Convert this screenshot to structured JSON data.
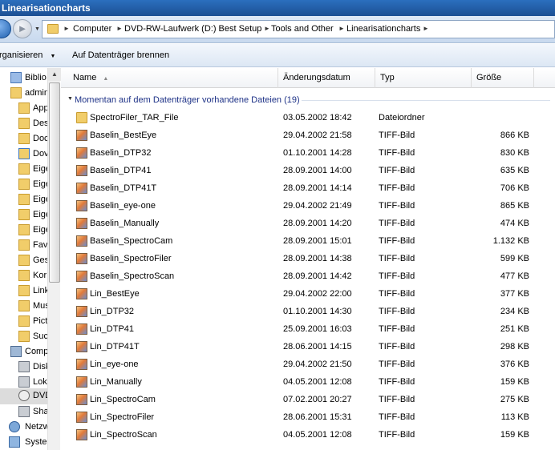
{
  "window": {
    "title": "Linearisationcharts"
  },
  "address": {
    "crumbs": [
      "Computer",
      "DVD-RW-Laufwerk (D:) Best Setup",
      "Tools and Other",
      "Linearisationcharts"
    ]
  },
  "toolbar": {
    "organize_label": "rganisieren",
    "burn_label": "Auf Datenträger brennen"
  },
  "navpane": {
    "items": [
      {
        "label": "Biblio",
        "icon": "library-icon"
      },
      {
        "label": "admin",
        "icon": "user-folder-icon"
      },
      {
        "label": "App",
        "icon": "folder-icon"
      },
      {
        "label": "Des",
        "icon": "folder-icon"
      },
      {
        "label": "Doc",
        "icon": "folder-icon"
      },
      {
        "label": "Dov",
        "icon": "download-folder-icon"
      },
      {
        "label": "Eige",
        "icon": "folder-icon"
      },
      {
        "label": "Eige",
        "icon": "folder-icon"
      },
      {
        "label": "Eige",
        "icon": "folder-icon"
      },
      {
        "label": "Eige",
        "icon": "folder-icon"
      },
      {
        "label": "Eige",
        "icon": "folder-icon"
      },
      {
        "label": "Fav",
        "icon": "folder-icon"
      },
      {
        "label": "Ges",
        "icon": "folder-icon"
      },
      {
        "label": "Kor",
        "icon": "folder-icon"
      },
      {
        "label": "Link",
        "icon": "folder-icon"
      },
      {
        "label": "Mus",
        "icon": "folder-icon"
      },
      {
        "label": "Pict",
        "icon": "folder-icon"
      },
      {
        "label": "Suc",
        "icon": "folder-icon"
      },
      {
        "label": "Comp",
        "icon": "computer-icon"
      },
      {
        "label": "Disk",
        "icon": "drive-icon"
      },
      {
        "label": "Lok",
        "icon": "drive-icon"
      },
      {
        "label": "DVD",
        "icon": "dvd-icon"
      },
      {
        "label": "Sha",
        "icon": "share-icon"
      },
      {
        "label": "Netzw",
        "icon": "network-icon"
      },
      {
        "label": "Syste",
        "icon": "control-panel-icon"
      }
    ]
  },
  "columns": {
    "name": "Name",
    "date": "Änderungsdatum",
    "type": "Typ",
    "size": "Größe"
  },
  "group_label": "Momentan auf dem Datenträger vorhandene Dateien (19)",
  "files": [
    {
      "name": "SpectroFiler_TAR_File",
      "date": "03.05.2002 18:42",
      "type": "Dateiordner",
      "size": "",
      "icon": "folder-icon"
    },
    {
      "name": "Baselin_BestEye",
      "date": "29.04.2002 21:58",
      "type": "TIFF-Bild",
      "size": "866 KB",
      "icon": "tiff-image-icon"
    },
    {
      "name": "Baselin_DTP32",
      "date": "01.10.2001 14:28",
      "type": "TIFF-Bild",
      "size": "830 KB",
      "icon": "tiff-image-icon"
    },
    {
      "name": "Baselin_DTP41",
      "date": "28.09.2001 14:00",
      "type": "TIFF-Bild",
      "size": "635 KB",
      "icon": "tiff-image-icon"
    },
    {
      "name": "Baselin_DTP41T",
      "date": "28.09.2001 14:14",
      "type": "TIFF-Bild",
      "size": "706 KB",
      "icon": "tiff-image-icon"
    },
    {
      "name": "Baselin_eye-one",
      "date": "29.04.2002 21:49",
      "type": "TIFF-Bild",
      "size": "865 KB",
      "icon": "tiff-image-icon"
    },
    {
      "name": "Baselin_Manually",
      "date": "28.09.2001 14:20",
      "type": "TIFF-Bild",
      "size": "474 KB",
      "icon": "tiff-image-icon"
    },
    {
      "name": "Baselin_SpectroCam",
      "date": "28.09.2001 15:01",
      "type": "TIFF-Bild",
      "size": "1.132 KB",
      "icon": "tiff-image-icon"
    },
    {
      "name": "Baselin_SpectroFiler",
      "date": "28.09.2001 14:38",
      "type": "TIFF-Bild",
      "size": "599 KB",
      "icon": "tiff-image-icon"
    },
    {
      "name": "Baselin_SpectroScan",
      "date": "28.09.2001 14:42",
      "type": "TIFF-Bild",
      "size": "477 KB",
      "icon": "tiff-image-icon"
    },
    {
      "name": "Lin_BestEye",
      "date": "29.04.2002 22:00",
      "type": "TIFF-Bild",
      "size": "377 KB",
      "icon": "tiff-image-icon"
    },
    {
      "name": "Lin_DTP32",
      "date": "01.10.2001 14:30",
      "type": "TIFF-Bild",
      "size": "234 KB",
      "icon": "tiff-image-icon"
    },
    {
      "name": "Lin_DTP41",
      "date": "25.09.2001 16:03",
      "type": "TIFF-Bild",
      "size": "251 KB",
      "icon": "tiff-image-icon"
    },
    {
      "name": "Lin_DTP41T",
      "date": "28.06.2001 14:15",
      "type": "TIFF-Bild",
      "size": "298 KB",
      "icon": "tiff-image-icon"
    },
    {
      "name": "Lin_eye-one",
      "date": "29.04.2002 21:50",
      "type": "TIFF-Bild",
      "size": "376 KB",
      "icon": "tiff-image-icon"
    },
    {
      "name": "Lin_Manually",
      "date": "04.05.2001 12:08",
      "type": "TIFF-Bild",
      "size": "159 KB",
      "icon": "tiff-image-icon"
    },
    {
      "name": "Lin_SpectroCam",
      "date": "07.02.2001 20:27",
      "type": "TIFF-Bild",
      "size": "275 KB",
      "icon": "tiff-image-icon"
    },
    {
      "name": "Lin_SpectroFiler",
      "date": "28.06.2001 15:31",
      "type": "TIFF-Bild",
      "size": "113 KB",
      "icon": "tiff-image-icon"
    },
    {
      "name": "Lin_SpectroScan",
      "date": "04.05.2001 12:08",
      "type": "TIFF-Bild",
      "size": "159 KB",
      "icon": "tiff-image-icon"
    }
  ]
}
